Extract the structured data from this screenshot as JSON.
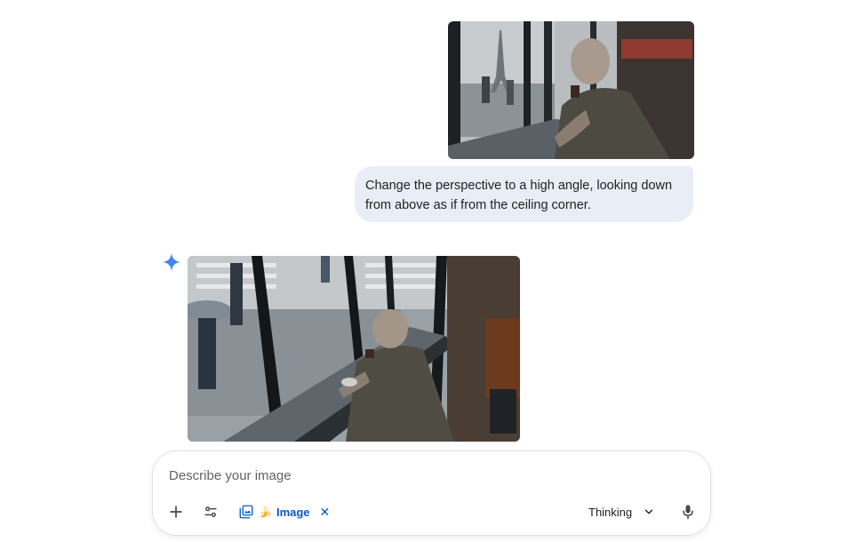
{
  "conversation": {
    "user_turn": {
      "image_icon": "uploaded-photo-cafe-window",
      "prompt_text": "Change the perspective to a high angle, looking down from above as if from the ceiling corner."
    },
    "model_turn": {
      "avatar_icon": "spark-icon",
      "image_icon": "generated-photo-high-angle"
    }
  },
  "composer": {
    "placeholder": "Describe your image",
    "value": "",
    "add_icon": "plus-icon",
    "tools_icon": "tune-icon",
    "tool_chip": {
      "icon": "image-library-icon",
      "emoji": "🍌",
      "label": "Image",
      "remove_label": "✕"
    },
    "mode": {
      "label": "Thinking",
      "icon": "chevron-down-icon"
    },
    "mic_icon": "mic-icon"
  },
  "colors": {
    "accent": "#0b57d0",
    "bubble_bg": "#e9eef6",
    "spark": "#4285f4",
    "text": "#1f1f1f",
    "border": "#dde3ea"
  }
}
